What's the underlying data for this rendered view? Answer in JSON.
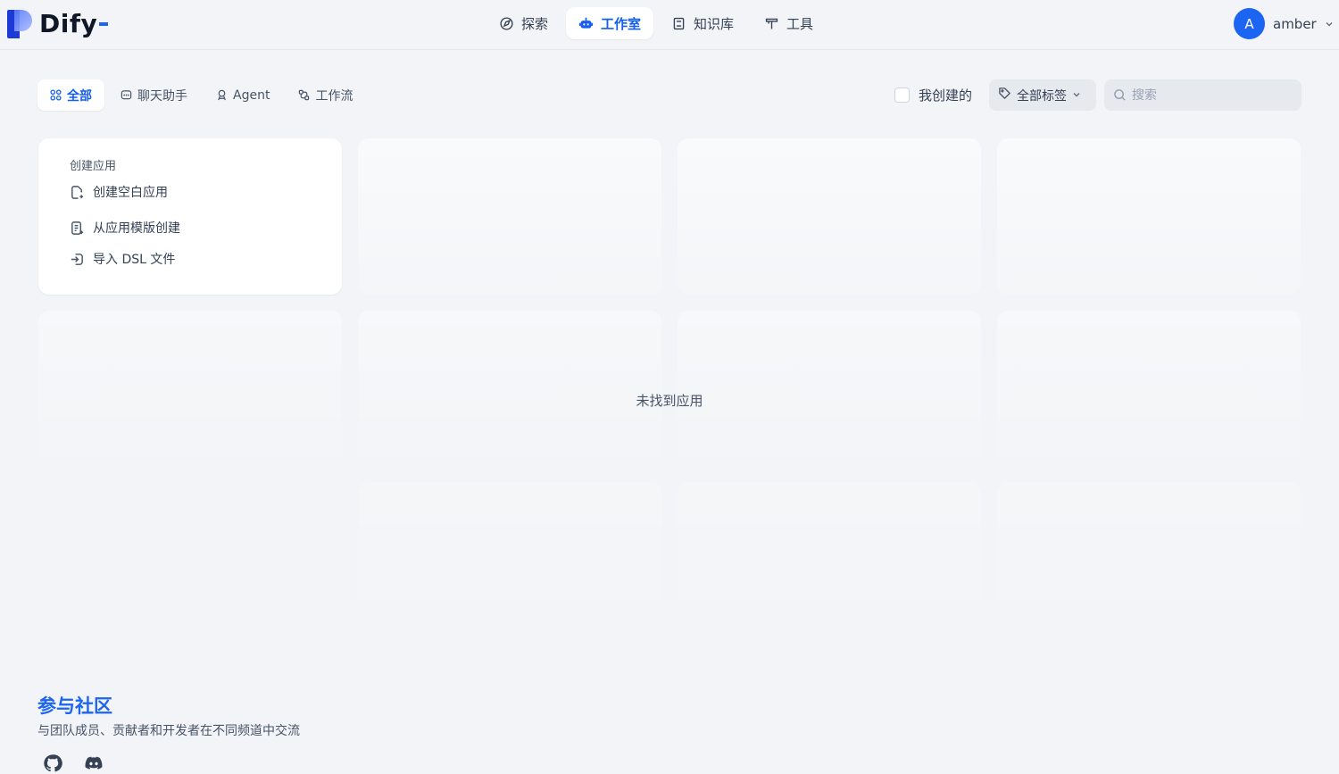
{
  "brand": {
    "name": "Dify"
  },
  "nav": [
    {
      "label": "探索",
      "icon": "compass-icon"
    },
    {
      "label": "工作室",
      "icon": "robot-icon",
      "active": true
    },
    {
      "label": "知识库",
      "icon": "book-icon"
    },
    {
      "label": "工具",
      "icon": "hammer-icon"
    }
  ],
  "user": {
    "initial": "A",
    "name": "amber"
  },
  "tabs": [
    {
      "label": "全部",
      "icon": "grid-icon",
      "active": true
    },
    {
      "label": "聊天助手",
      "icon": "chat-icon"
    },
    {
      "label": "Agent",
      "icon": "agent-icon"
    },
    {
      "label": "工作流",
      "icon": "workflow-icon"
    }
  ],
  "filters": {
    "created_by_me": "我创建的",
    "tag_label": "全部标签",
    "search_placeholder": "搜索"
  },
  "create": {
    "title": "创建应用",
    "items": [
      {
        "label": "创建空白应用",
        "icon": "new-file-icon"
      },
      {
        "label": "从应用模版创建",
        "icon": "template-icon"
      },
      {
        "label": "导入 DSL 文件",
        "icon": "import-icon"
      }
    ]
  },
  "empty_state": "未找到应用",
  "community": {
    "title": "参与社区",
    "description": "与团队成员、贡献者和开发者在不同频道中交流"
  },
  "colors": {
    "accent": "#155eef",
    "background": "#f2f4f7",
    "avatar": "#1c64f2"
  }
}
